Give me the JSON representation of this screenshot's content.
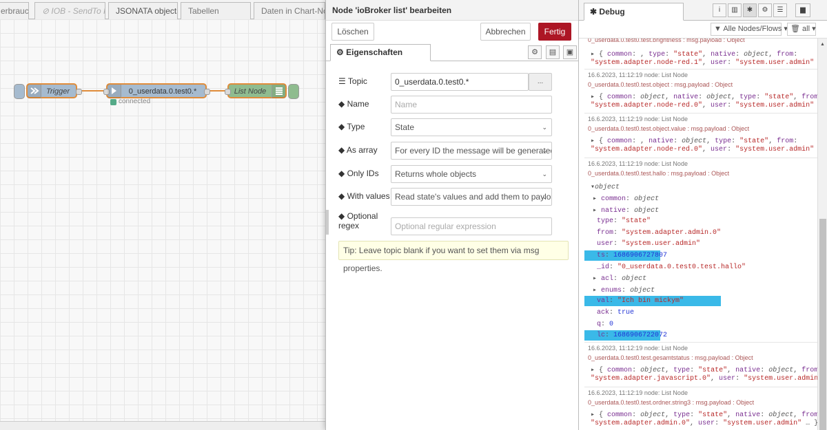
{
  "workspace": {
    "tabs": [
      "erbrauch",
      "IOB - SendTo Pr",
      "JSONATA objects",
      "Tabellen",
      "Daten in Chart-Nod"
    ],
    "disabled_icon": "⊘",
    "nodes": {
      "trigger": {
        "label": "Trigger",
        "color": "#a6bbcf"
      },
      "ioget": {
        "label": "0_userdata.0.test0.*",
        "status": "connected",
        "color": "#a6bbcf"
      },
      "list": {
        "label": "List Node",
        "color": "#8fbc8f"
      }
    }
  },
  "tray": {
    "title": "Node 'ioBroker list' bearbeiten",
    "delete_label": "Löschen",
    "cancel_label": "Abbrechen",
    "done_label": "Fertig",
    "tab_label": "Eigenschaften",
    "fields": {
      "topic": {
        "label": "Topic",
        "value": "0_userdata.0.test0.*",
        "button": "..."
      },
      "name": {
        "label": "Name",
        "placeholder": "Name"
      },
      "type": {
        "label": "Type",
        "value": "State"
      },
      "as_array": {
        "label": "As array",
        "value": "For every ID the message will be generated"
      },
      "only_ids": {
        "label": "Only IDs",
        "value": "Returns whole objects"
      },
      "with_values": {
        "label": "With values",
        "value": "Read state's values and add them to payload"
      },
      "regex": {
        "label1": "Optional",
        "label2": "regex",
        "placeholder": "Optional regular expression"
      }
    },
    "tip": "Tip: Leave topic blank if you want to set them via msg properties."
  },
  "sidebar": {
    "title": "Debug",
    "filter_label": "Alle Nodes/Flows",
    "clear_label": "all",
    "messages": [
      {
        "topic": "0_userdata.0.test0.test.brightness : msg.payload : Object",
        "l1": [
          "{ ",
          "common",
          ": , ",
          "type",
          ": ",
          "\"state\"",
          ", ",
          "native",
          ": ",
          "object",
          ", ",
          "from",
          ":"
        ],
        "l2": [
          "\"system.adapter.node-red.1\"",
          ", ",
          "user",
          ": ",
          "\"system.user.admin\"",
          " … }"
        ]
      },
      {
        "header": "16.6.2023, 11:12:19   node: List Node",
        "topic": "0_userdata.0.test0.test.object : msg.payload : Object",
        "l1": [
          "{ ",
          "common",
          ": ",
          "object",
          ", ",
          "native",
          ": ",
          "object",
          ", ",
          "type",
          ": ",
          "\"state\"",
          ", ",
          "from",
          ":"
        ],
        "l2": [
          "\"system.adapter.node-red.0\"",
          ", ",
          "user",
          ": ",
          "\"system.user.admin\"",
          " … }"
        ]
      },
      {
        "header": "16.6.2023, 11:12:19   node: List Node",
        "topic": "0_userdata.0.test0.test.object.value : msg.payload : Object",
        "l1": [
          "{ ",
          "common",
          ": , ",
          "native",
          ": ",
          "object",
          ", ",
          "type",
          ": ",
          "\"state\"",
          ", ",
          "from",
          ":"
        ],
        "l2": [
          "\"system.adapter.node-red.0\"",
          ", ",
          "user",
          ": ",
          "\"system.user.admin\"",
          " … }"
        ]
      },
      {
        "header": "16.6.2023, 11:12:19   node: List Node",
        "topic": "0_userdata.0.test0.test.hallo : msg.payload : Object"
      },
      {
        "header": "16.6.2023, 11:12:19   node: List Node",
        "topic": "0_userdata.0.test0.test.gesamtstatus : msg.payload : Object",
        "l1": [
          "{ ",
          "common",
          ": ",
          "object",
          ", ",
          "type",
          ": ",
          "\"state\"",
          ", ",
          "native",
          ": ",
          "object",
          ", ",
          "from",
          ":"
        ],
        "l2": [
          "\"system.adapter.javascript.0\"",
          ", ",
          "user",
          ": ",
          "\"system.user.admin\"",
          " … }"
        ]
      },
      {
        "header": "16.6.2023, 11:12:19   node: List Node",
        "topic": "0_userdata.0.test0.test.ordner.string3 : msg.payload : Object",
        "l1": [
          "{ ",
          "common",
          ": ",
          "object",
          ", ",
          "type",
          ": ",
          "\"state\"",
          ", ",
          "native",
          ": ",
          "object",
          ", ",
          "from",
          ":"
        ],
        "l2": [
          "\"system.adapter.admin.0\"",
          ", ",
          "user",
          ": ",
          "\"system.user.admin\"",
          " … }"
        ]
      }
    ],
    "expanded": {
      "root": "object",
      "props": [
        {
          "key": "common",
          "val": "object",
          "kind": "o",
          "tri": true
        },
        {
          "key": "native",
          "val": "object",
          "kind": "o",
          "tri": true
        },
        {
          "key": "type",
          "val": "\"state\"",
          "kind": "s"
        },
        {
          "key": "from",
          "val": "\"system.adapter.admin.0\"",
          "kind": "s"
        },
        {
          "key": "user",
          "val": "\"system.user.admin\"",
          "kind": "s"
        },
        {
          "key": "ts",
          "val": "1686906727807",
          "kind": "n",
          "hl": true
        },
        {
          "key": "_id",
          "val": "\"0_userdata.0.test0.test.hallo\"",
          "kind": "s"
        },
        {
          "key": "acl",
          "val": "object",
          "kind": "o",
          "tri": true
        },
        {
          "key": "enums",
          "val": "object",
          "kind": "o",
          "tri": true
        },
        {
          "key": "val",
          "val": "\"Ich bin mickym\"",
          "kind": "s",
          "hl": true
        },
        {
          "key": "ack",
          "val": "true",
          "kind": "b"
        },
        {
          "key": "q",
          "val": "0",
          "kind": "n"
        },
        {
          "key": "lc",
          "val": "1686906722072",
          "kind": "n",
          "hl": true
        }
      ]
    }
  }
}
